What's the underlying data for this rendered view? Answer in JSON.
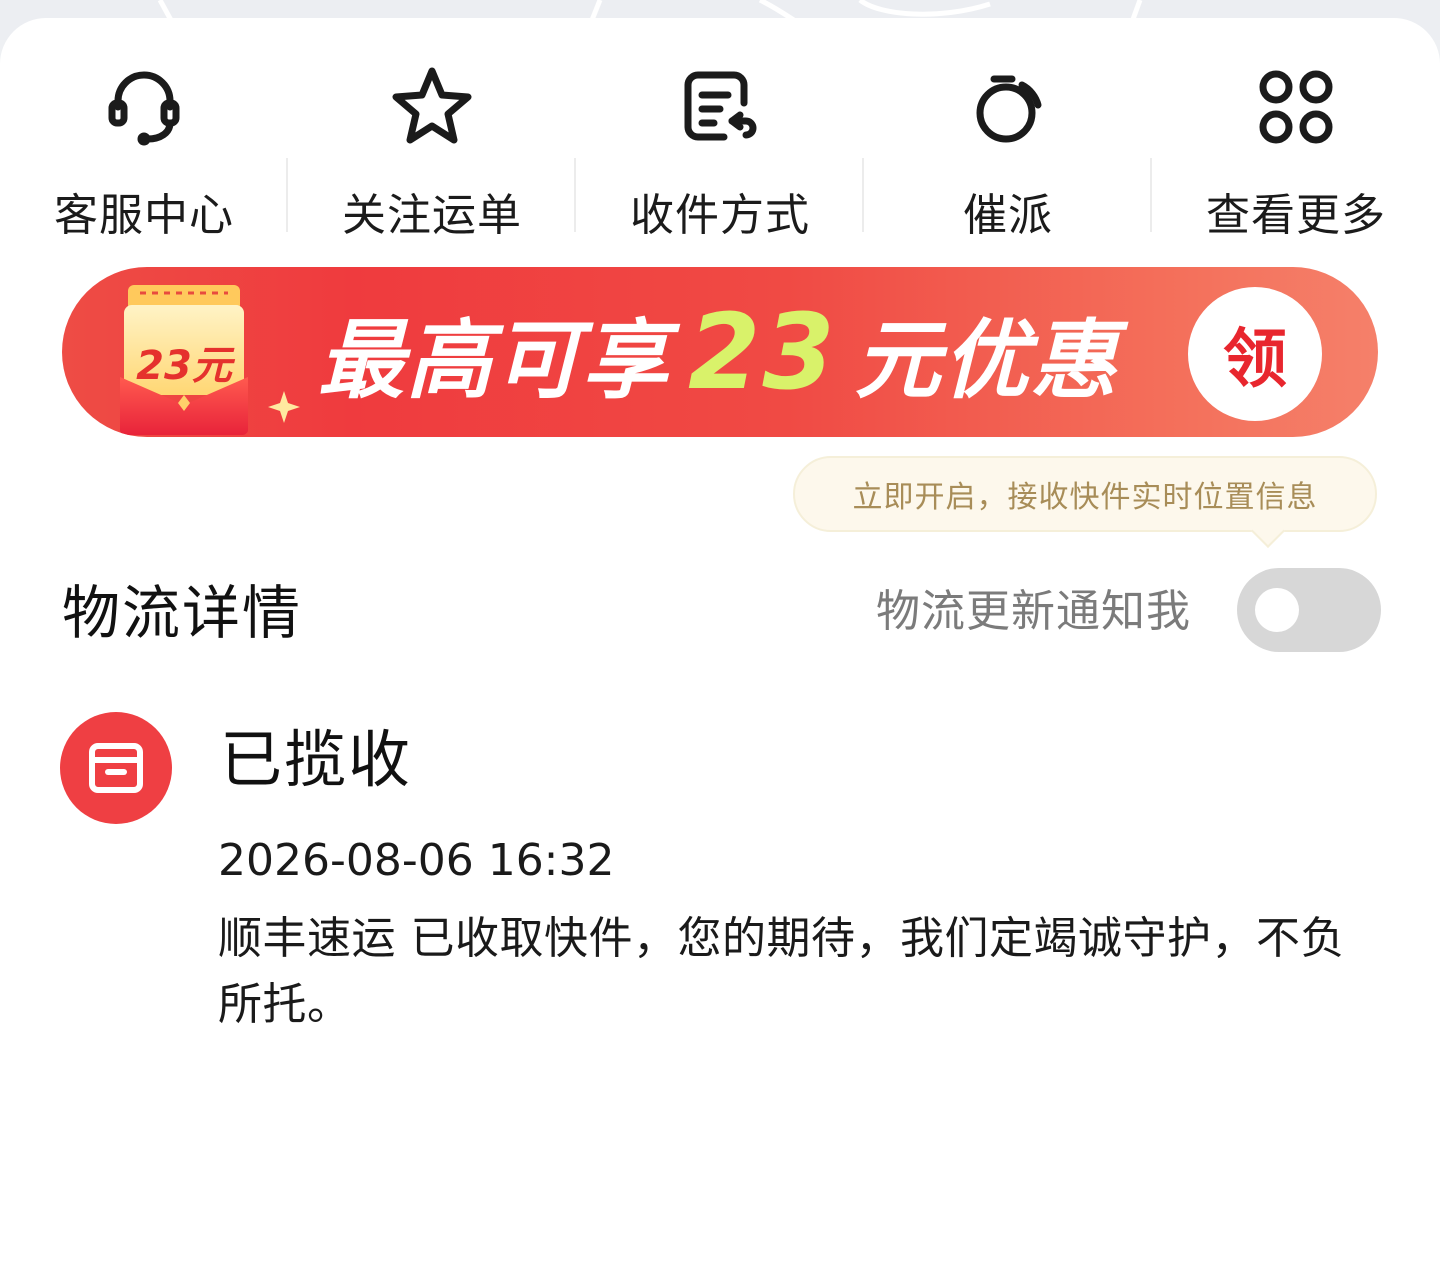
{
  "quick_actions": [
    {
      "label": "客服中心",
      "icon": "headset-icon"
    },
    {
      "label": "关注运单",
      "icon": "star-icon"
    },
    {
      "label": "收件方式",
      "icon": "delivery-method-icon"
    },
    {
      "label": "催派",
      "icon": "urge-delivery-icon"
    },
    {
      "label": "查看更多",
      "icon": "more-grid-icon"
    }
  ],
  "promo": {
    "gift_amount": "23元",
    "headline_prefix": "最高可享",
    "headline_amount": "23",
    "headline_suffix": "元优惠",
    "claim_label": "领"
  },
  "tooltip": {
    "text": "立即开启，接收快件实时位置信息"
  },
  "logistics": {
    "title": "物流详情",
    "notify_label": "物流更新通知我",
    "notify_enabled": false
  },
  "event": {
    "status": "已揽收",
    "time": "2026-08-06 16:32",
    "description": "顺丰速运 已收取快件，您的期待，我们定竭诚守护，不负所托。",
    "icon": "package-box-icon"
  },
  "colors": {
    "brand_red": "#ef3f43",
    "banner_accent": "#d9f26a",
    "tooltip_text": "#a88d58"
  }
}
